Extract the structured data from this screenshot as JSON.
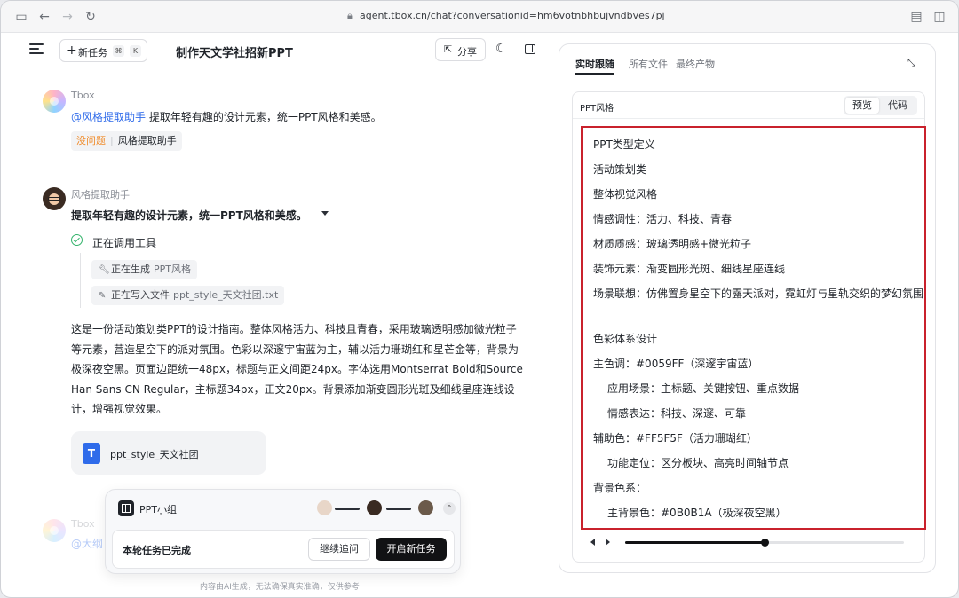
{
  "browser": {
    "url": "agent.tbox.cn/chat?conversationid=hm6votnbhbujvndbves7pj"
  },
  "header": {
    "new_task_label": "新任务",
    "kbd_cmd": "⌘",
    "kbd_k": "K",
    "title": "制作天文学社招新PPT",
    "share_label": "分享"
  },
  "messages": {
    "m1": {
      "sender": "Tbox",
      "mention": "@风格提取助手",
      "text": " 提取年轻有趣的设计元素，统一PPT风格和美感。",
      "tag_status": "没问题",
      "tag_agent": "风格提取助手"
    },
    "m2": {
      "sender": "风格提取助手",
      "heading": "提取年轻有趣的设计元素，统一PPT风格和美感。",
      "tool_status": "正在调用工具",
      "tool1_action": "正在生成",
      "tool1_target": "PPT风格",
      "tool2_action": "正在写入文件",
      "tool2_target": "ppt_style_天文社团.txt",
      "paragraph": "这是一份活动策划类PPT的设计指南。整体风格活力、科技且青春，采用玻璃透明感加微光粒子等元素，营造星空下的派对氛围。色彩以深邃宇宙蓝为主，辅以活力珊瑚红和星芒金等，背景为极深夜空黑。页面边距统一48px，标题与正文间距24px。字体选用Montserrat Bold和Source Han Sans CN Regular，主标题34px，正文20px。背景添加渐变圆形光斑及细线星座连线设计，增强视觉效果。",
      "file_name": "ppt_style_天文社团"
    },
    "m3": {
      "sender": "Tbox",
      "mention": "@大纲"
    }
  },
  "group": {
    "name": "PPT小组",
    "status_text": "本轮任务已完成",
    "follow_label": "继续追问",
    "new_label": "开启新任务"
  },
  "disclaimer": "内容由AI生成，无法确保真实准确，仅供参考",
  "right_panel": {
    "tabs": [
      "实时跟随",
      "所有文件",
      "最终产物"
    ],
    "viewer_title": "PPT风格",
    "seg_preview": "预览",
    "seg_code": "代码",
    "lines": [
      "PPT类型定义",
      "活动策划类",
      "整体视觉风格",
      "情感调性：活力、科技、青春",
      "材质质感：玻璃透明感+微光粒子",
      "装饰元素：渐变圆形光斑、细线星座连线",
      "场景联想：仿佛置身星空下的露天派对，霓虹灯与星轨交织的梦幻氛围",
      "色彩体系设计",
      "主色调：#0059FF（深邃宇宙蓝）",
      "应用场景：主标题、关键按钮、重点数据",
      "情感表达：科技、深邃、可靠",
      "辅助色：#FF5F5F（活力珊瑚红）",
      "功能定位：区分板块、高亮时间轴节点",
      "背景色系：",
      "主背景色：#0B0B1A（极深夜空黑）"
    ],
    "progress": 0.5
  },
  "colors": {
    "accent_blue": "#2f6bea",
    "highlight_red": "#c9212c",
    "tag_orange": "#f08c2b"
  }
}
